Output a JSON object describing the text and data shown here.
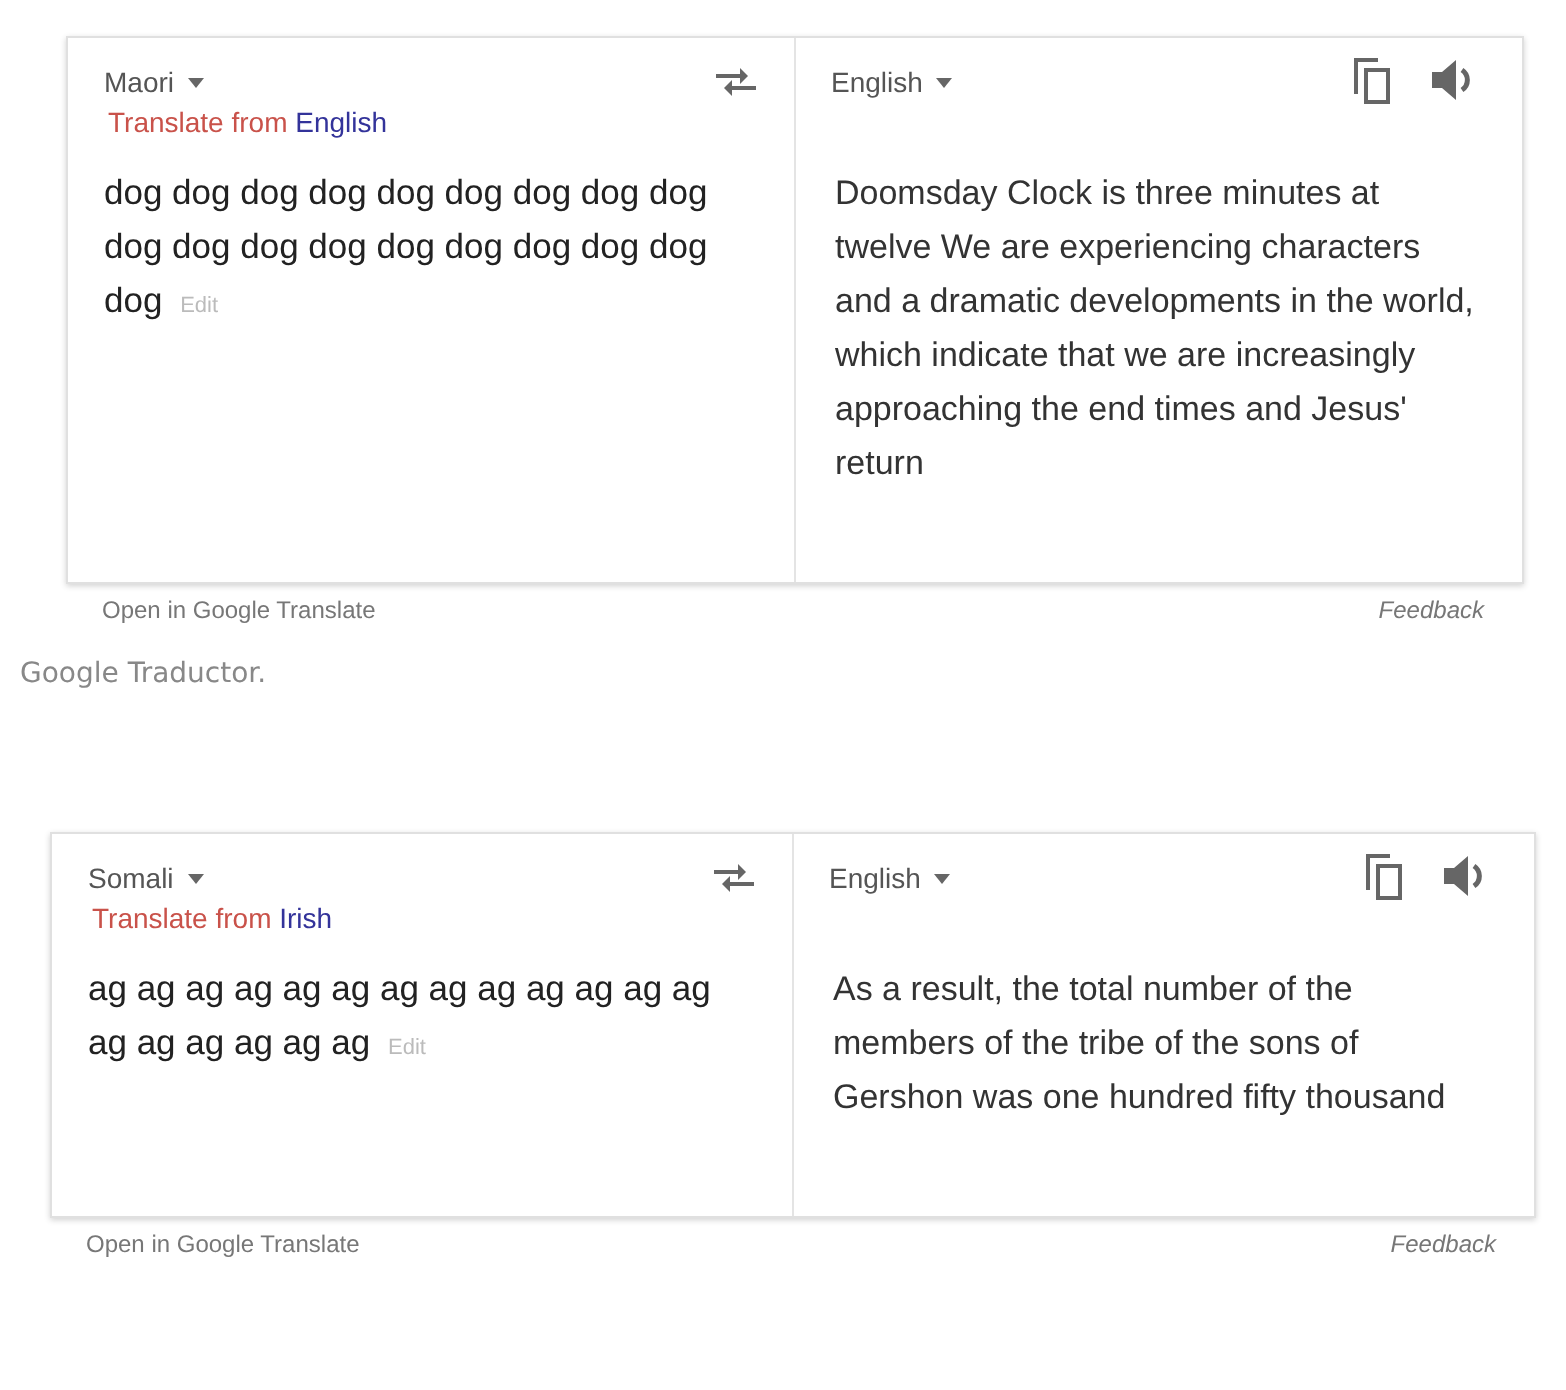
{
  "blocks": [
    {
      "kind": "translator",
      "source_language": "Maori",
      "detected_prefix": "Translate from",
      "detected_language": "English",
      "source_text": "dog dog dog dog dog dog dog dog dog dog dog dog dog dog dog dog dog dog dog",
      "edit_link": "Edit",
      "target_language": "English",
      "translation": "Doomsday Clock is three minutes at twelve We are experiencing characters and a dramatic developments in the world, which indicate that we are increasingly approaching the end times and Jesus' return",
      "open_link": "Open in Google Translate",
      "feedback_link": "Feedback"
    },
    {
      "kind": "caption",
      "text": "Google Traductor."
    },
    {
      "kind": "translator",
      "source_language": "Somali",
      "detected_prefix": "Translate from",
      "detected_language": "Irish",
      "source_text": "ag ag ag ag ag ag ag ag ag ag ag ag ag ag ag ag ag ag ag",
      "edit_link": "Edit",
      "target_language": "English",
      "translation": "As a result, the total number of the members of the tribe of the sons of Gershon was one hundred fifty thousand",
      "open_link": "Open in Google Translate",
      "feedback_link": "Feedback"
    }
  ]
}
